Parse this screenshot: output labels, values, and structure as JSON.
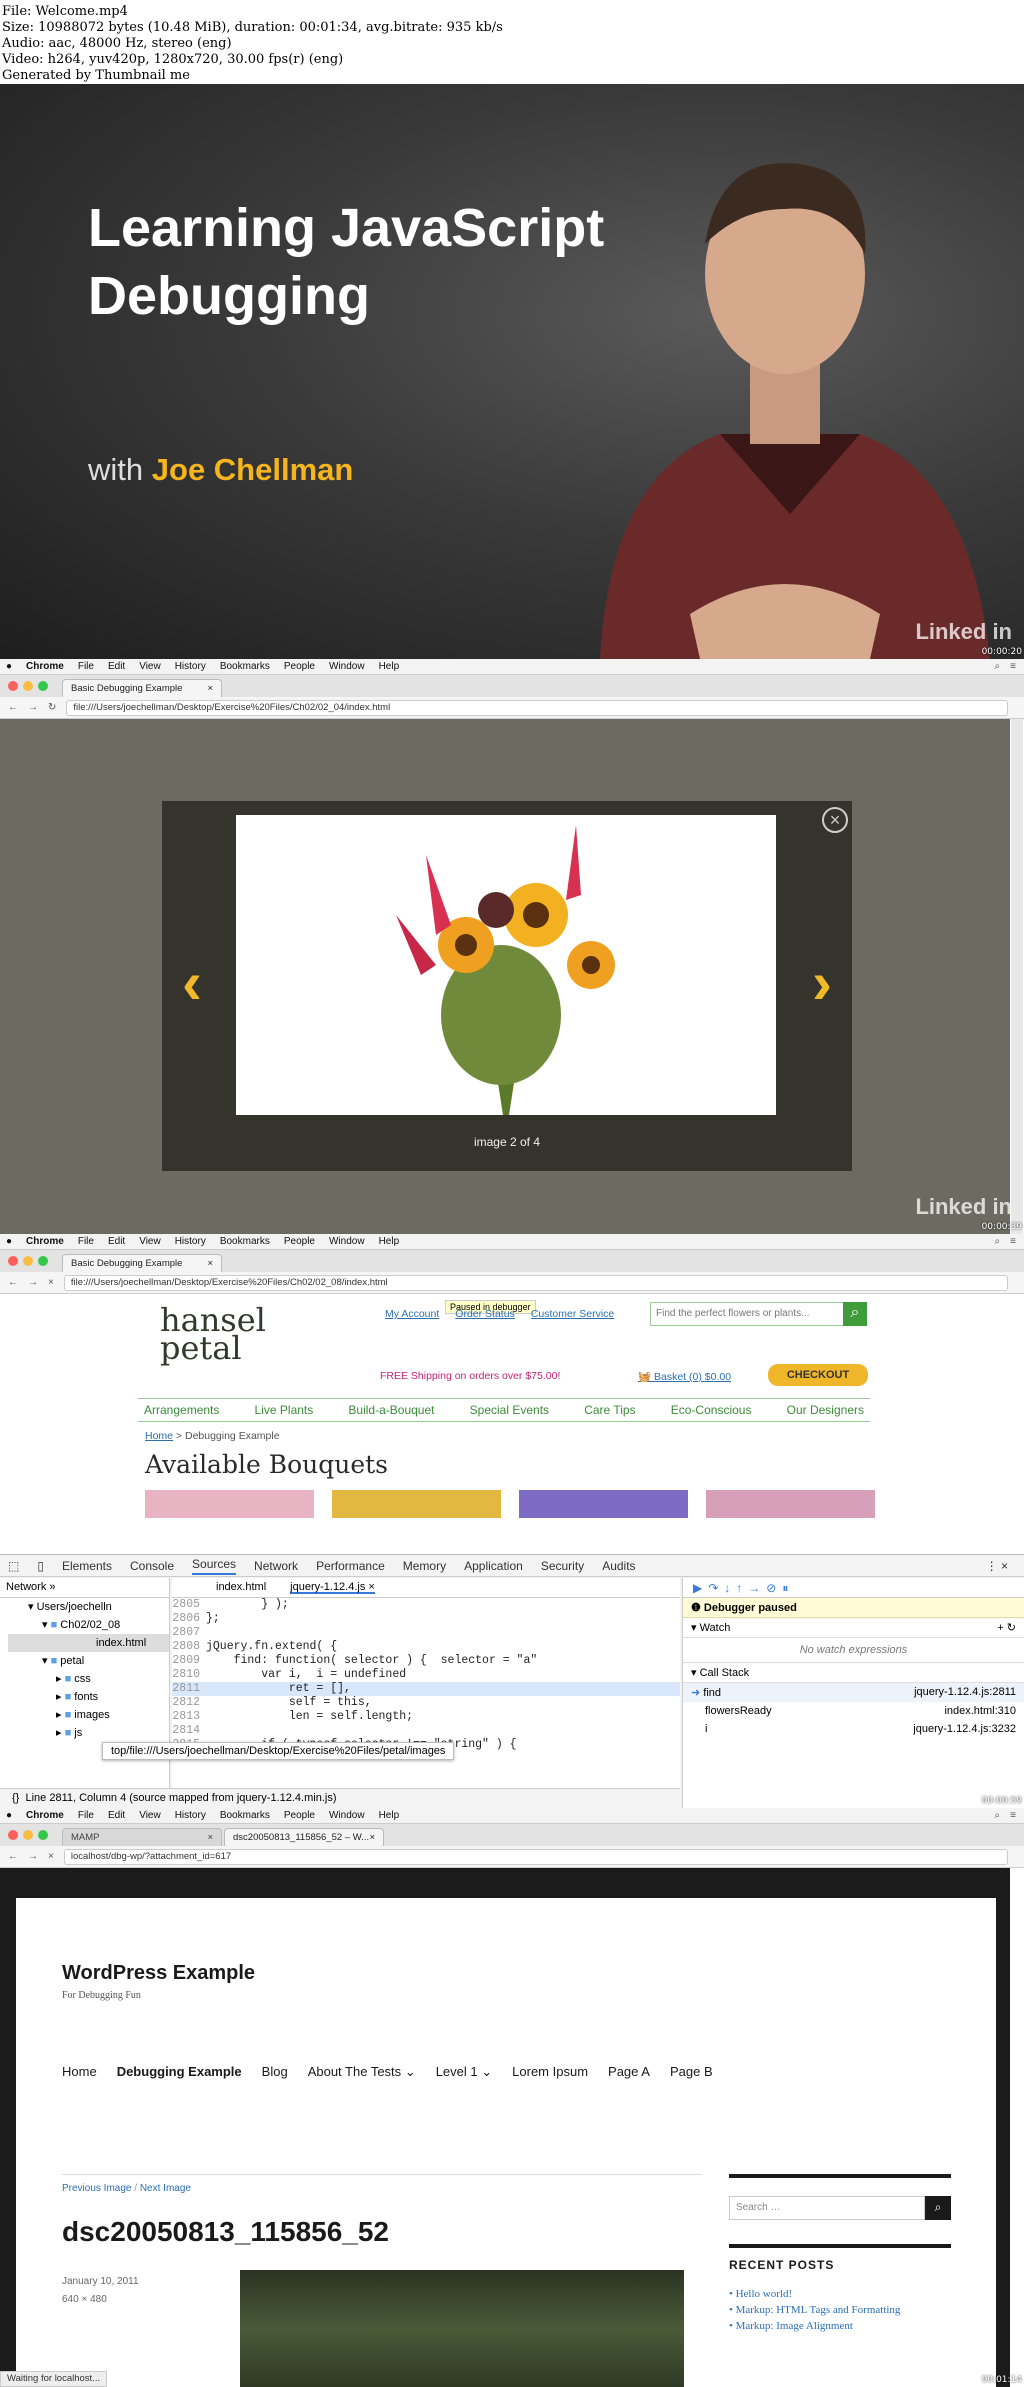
{
  "header": {
    "lines": [
      "File: Welcome.mp4",
      "Size: 10988072 bytes (10.48 MiB), duration: 00:01:34, avg.bitrate: 935 kb/s",
      "Audio: aac, 48000 Hz, stereo (eng)",
      "Video: h264, yuv420p, 1280x720, 30.00 fps(r) (eng)",
      "Generated by Thumbnail me"
    ]
  },
  "frame1": {
    "title_line1": "Learning JavaScript",
    "title_line2": "Debugging",
    "with": "with",
    "author": "Joe Chellman",
    "logo": "Linked in",
    "timestamp": "00:00:20"
  },
  "mac_menu": {
    "apple": "",
    "items": [
      "Chrome",
      "File",
      "Edit",
      "View",
      "History",
      "Bookmarks",
      "People",
      "Window",
      "Help"
    ]
  },
  "frame2": {
    "tab_label": "Basic Debugging Example",
    "url": "file:///Users/joechellman/Desktop/Exercise%20Files/Ch02/02_04/index.html",
    "caption": "image 2 of 4",
    "logo": "Linked in",
    "timestamp": "00:00:39"
  },
  "frame3": {
    "tab_label": "Basic Debugging Example",
    "url": "file:///Users/joechellman/Desktop/Exercise%20Files/Ch02/02_08/index.html",
    "paused": "Paused in debugger",
    "brand_top": "hansel",
    "brand_bottom": "petal",
    "links": [
      "My Account",
      "Order Status",
      "Customer Service"
    ],
    "search_placeholder": "Find the perfect flowers or plants...",
    "shipping": "FREE Shipping on orders over $75.00!",
    "basket": "Basket (0) $0.00",
    "checkout": "CHECKOUT",
    "nav": [
      "Arrangements",
      "Live Plants",
      "Build-a-Bouquet",
      "Special Events",
      "Care Tips",
      "Eco-Conscious",
      "Our Designers"
    ],
    "breadcrumb_home": "Home",
    "breadcrumb_rest": " > Debugging Example",
    "heading": "Available Bouquets",
    "devtools_tabs": [
      "Elements",
      "Console",
      "Sources",
      "Network",
      "Performance",
      "Memory",
      "Application",
      "Security",
      "Audits"
    ],
    "nav_panel_tab": "Network",
    "tree": [
      "Users/joechelln",
      "Ch02/02_08",
      "index.html",
      "petal",
      "css",
      "fonts",
      "images",
      "js"
    ],
    "file_tabs": [
      "index.html",
      "jquery-1.12.4.js"
    ],
    "code_lines": [
      {
        "n": "2805",
        "t": "        } );"
      },
      {
        "n": "2806",
        "t": "};"
      },
      {
        "n": "2807",
        "t": ""
      },
      {
        "n": "2808",
        "t": "jQuery.fn.extend( {"
      },
      {
        "n": "2809",
        "t": "    find: function( selector ) {  selector = \"a\""
      },
      {
        "n": "2810",
        "t": "        var i,  i = undefined"
      },
      {
        "n": "2811",
        "t": "            ret = [],"
      },
      {
        "n": "2812",
        "t": "            self = this,"
      },
      {
        "n": "2813",
        "t": "            len = self.length;"
      },
      {
        "n": "2814",
        "t": ""
      },
      {
        "n": "2815",
        "t": "        if ( typeof selector !== \"string\" ) {"
      }
    ],
    "tooltip": "top/file:///Users/joechellman/Desktop/Exercise%20Files/petal/images",
    "status": "Line 2811, Column 4  (source mapped from jquery-1.12.4.min.js)",
    "status_icon": "{}",
    "debugger_paused": "Debugger paused",
    "watch": "Watch",
    "no_watch": "No watch expressions",
    "call_stack": "Call Stack",
    "stack": [
      {
        "fn": "find",
        "loc": "jquery-1.12.4.js:2811"
      },
      {
        "fn": "flowersReady",
        "loc": "index.html:310"
      },
      {
        "fn": "i",
        "loc": "jquery-1.12.4.js:3232"
      }
    ],
    "timestamp": "00:00:59"
  },
  "frame4": {
    "tab1": "MAMP",
    "tab2": "dsc20050813_115856_52 – W...",
    "url": "localhost/dbg-wp/?attachment_id=617",
    "site_title": "WordPress Example",
    "tagline": "For Debugging Fun",
    "nav": [
      "Home",
      "Debugging Example",
      "Blog",
      "About The Tests",
      "Level 1",
      "Lorem Ipsum",
      "Page A",
      "Page B"
    ],
    "prev": "Previous Image",
    "sep": "/",
    "next": "Next Image",
    "post_title": "dsc20050813_115856_52",
    "date": "January 10, 2011",
    "dims": "640 × 480",
    "search_placeholder": "Search …",
    "recent_posts": "RECENT POSTS",
    "recent": [
      "Hello world!",
      "Markup: HTML Tags and Formatting",
      "Markup: Image Alignment"
    ],
    "status": "Waiting for localhost...",
    "timestamp": "00:01:14"
  }
}
